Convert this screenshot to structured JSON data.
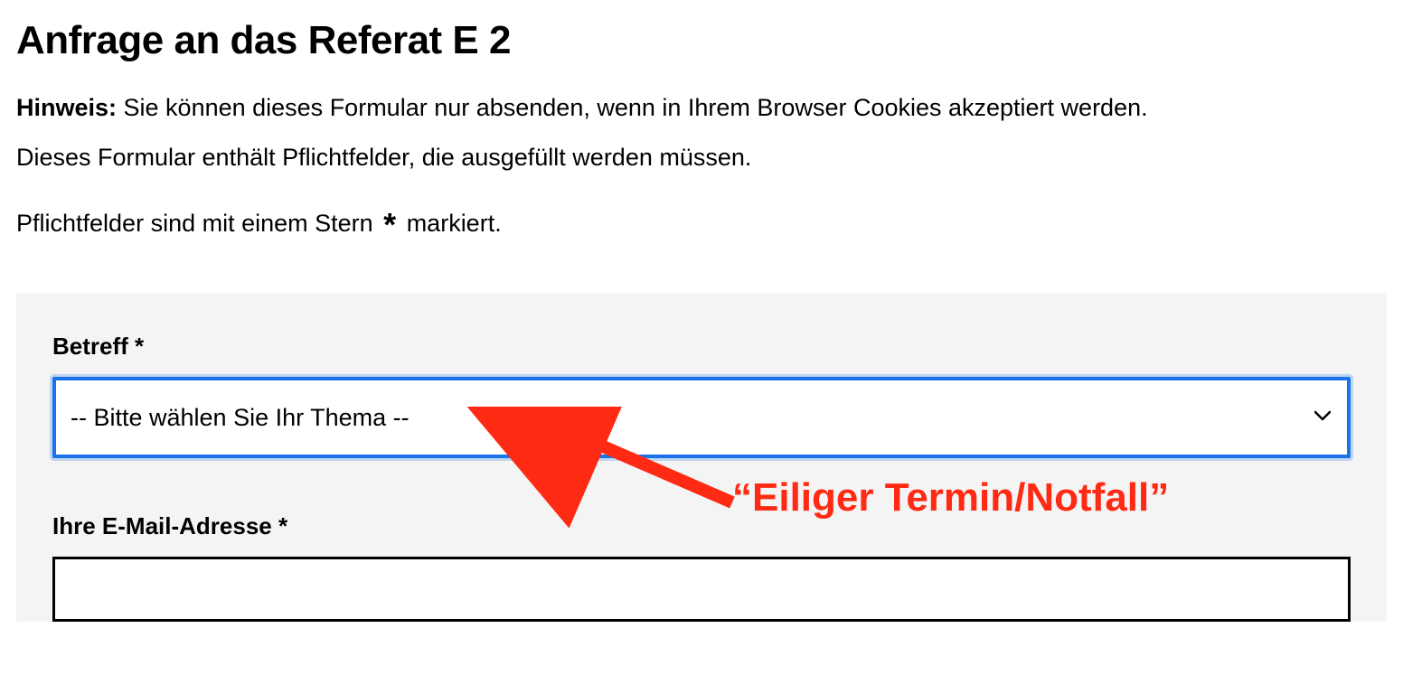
{
  "page": {
    "title": "Anfrage an das Referat E 2"
  },
  "notice": {
    "label": "Hinweis:",
    "text_line1": " Sie können dieses Formular nur absenden, wenn in Ihrem Browser Cookies akzeptiert werden.",
    "text_line2": "Dieses Formular enthält Pflichtfelder, die ausgefüllt werden müssen."
  },
  "mandatory_note": {
    "prefix": "Pflichtfelder sind mit einem Stern ",
    "asterisk": "*",
    "suffix": " markiert."
  },
  "form": {
    "betreff": {
      "label": "Betreff *",
      "selected": "-- Bitte wählen Sie Ihr Thema --"
    },
    "email": {
      "label": "Ihre E-Mail-Adresse *",
      "value": ""
    }
  },
  "annotation": {
    "text": "“Eiliger Termin/Notfall”",
    "color": "#ff2a14"
  }
}
